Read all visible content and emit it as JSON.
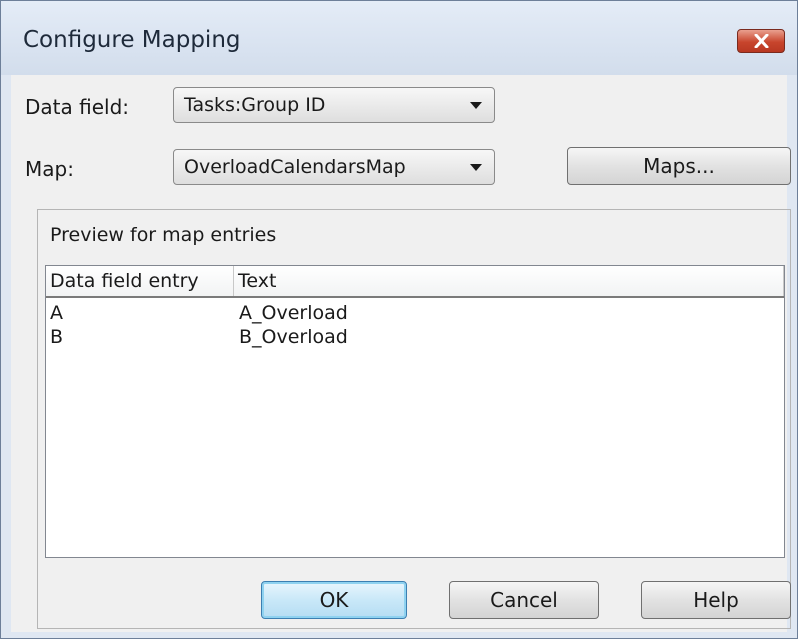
{
  "dialog": {
    "title": "Configure Mapping"
  },
  "data_field": {
    "label": "Data field:",
    "value": "Tasks:Group ID"
  },
  "map": {
    "label": "Map:",
    "value": "OverloadCalendarsMap"
  },
  "buttons": {
    "maps": "Maps...",
    "ok": "OK",
    "cancel": "Cancel",
    "help": "Help"
  },
  "preview": {
    "caption": "Preview for map entries",
    "columns": [
      "Data field entry",
      "Text"
    ],
    "rows": [
      {
        "entry": "A",
        "text": "A_Overload"
      },
      {
        "entry": "B",
        "text": "B_Overload"
      }
    ]
  },
  "colors": {
    "accent_default_button": "#3c7fb1",
    "close_button": "#c8452d",
    "title_bar": "#dfe7f2"
  },
  "icons": {
    "close": "close-icon",
    "combo_arrow": "chevron-down-icon"
  }
}
